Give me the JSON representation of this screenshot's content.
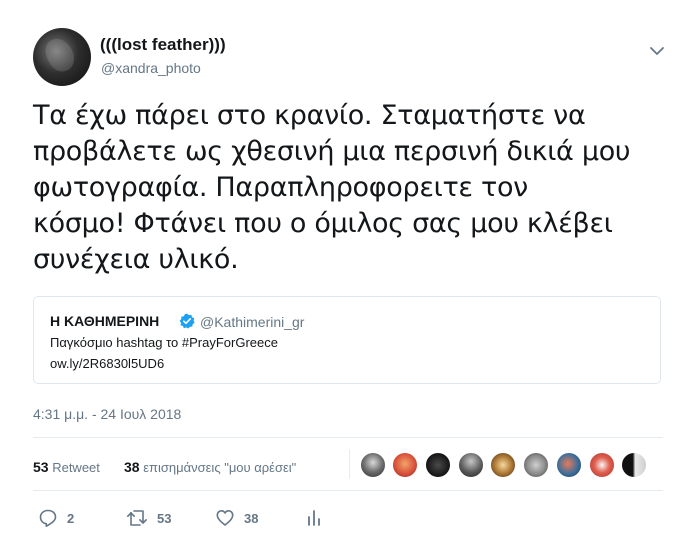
{
  "author": {
    "display_name": "(((lost feather)))",
    "handle": "@xandra_photo",
    "avatar_icon": "profile-photo",
    "menu_icon": "chevron-down-icon"
  },
  "tweet": {
    "lines": [
      "Τα έχω πάρει στο κρανίο. Σταματήστε να",
      "προβάλετε ως χθεσινή μια περσινή δικιά μου",
      "φωτογραφία. Παραπληροφορειτε τον",
      "κόσμο! Φτάνει που ο όμιλος σας μου κλέβει",
      "συνέχεια υλικό."
    ]
  },
  "quoted_tweet": {
    "display_name": "Η ΚΑΘΗΜΕΡΙΝΗ",
    "verified_icon": "verified-badge-icon",
    "handle": "@Kathimerini_gr",
    "line1": "Παγκόσμιο hashtag το #PrayForGreece",
    "line2": "ow.ly/2R6830l5UD6"
  },
  "timestamp": "4:31 μ.μ. - 24 Ιουλ 2018",
  "stats": {
    "retweet_count": "53",
    "retweet_label": "Retweet",
    "like_count": "38",
    "like_label": "επισημάνσεις \"μου αρέσει\""
  },
  "liker_avatars": [
    "avatar-1",
    "avatar-2",
    "avatar-3",
    "avatar-4",
    "avatar-5",
    "avatar-6",
    "avatar-7",
    "avatar-8",
    "avatar-9"
  ],
  "actions": {
    "reply": {
      "icon": "reply-icon",
      "count": "2"
    },
    "retweet": {
      "icon": "retweet-icon",
      "count": "53"
    },
    "like": {
      "icon": "heart-icon",
      "count": "38"
    },
    "analytics": {
      "icon": "analytics-icon"
    }
  },
  "colors": {
    "text": "#14171a",
    "secondary": "#657786",
    "border": "#e1e8ed",
    "verified": "#1da1f2"
  }
}
